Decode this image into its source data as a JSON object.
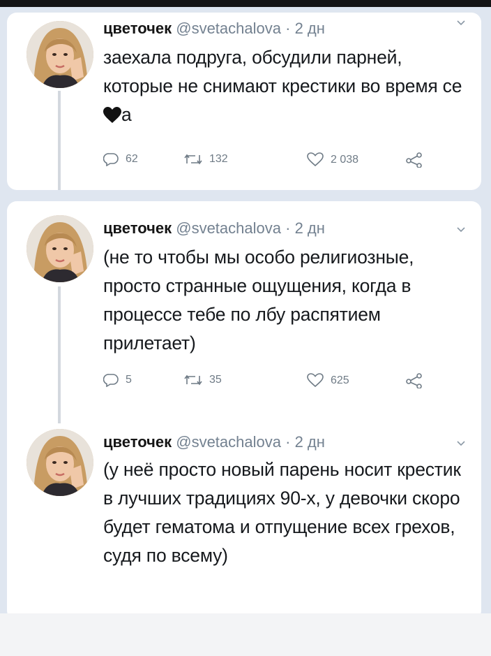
{
  "tweets": [
    {
      "name": "цветочек",
      "handle": "@svetachalova",
      "dot": "·",
      "time": "2 дн",
      "text_before_emoji": "заехала подруга, обсудили парней, которые не снимают крестики во время се",
      "text_after_emoji": "а",
      "emoji_icon": "black-heart-icon",
      "replies": "62",
      "retweets": "132",
      "likes": "2 038"
    },
    {
      "name": "цветочек",
      "handle": "@svetachalova",
      "dot": "·",
      "time": "2 дн",
      "text": "(не то чтобы мы особо религиозные, просто странные ощущения, когда в процессе тебе по лбу распятием прилетает)",
      "replies": "5",
      "retweets": "35",
      "likes": "625"
    },
    {
      "name": "цветочек",
      "handle": "@svetachalova",
      "dot": "·",
      "time": "2 дн",
      "text": "(у неё просто новый парень носит крестик в лучших традициях 90-х, у девочки скоро будет гематома и отпущение всех грехов, судя по всему)"
    }
  ],
  "colors": {
    "name": "#151515",
    "handle": "#738190",
    "text": "#16191d",
    "thread_line": "#d3d8de",
    "page_background": "#dfe6f0"
  }
}
